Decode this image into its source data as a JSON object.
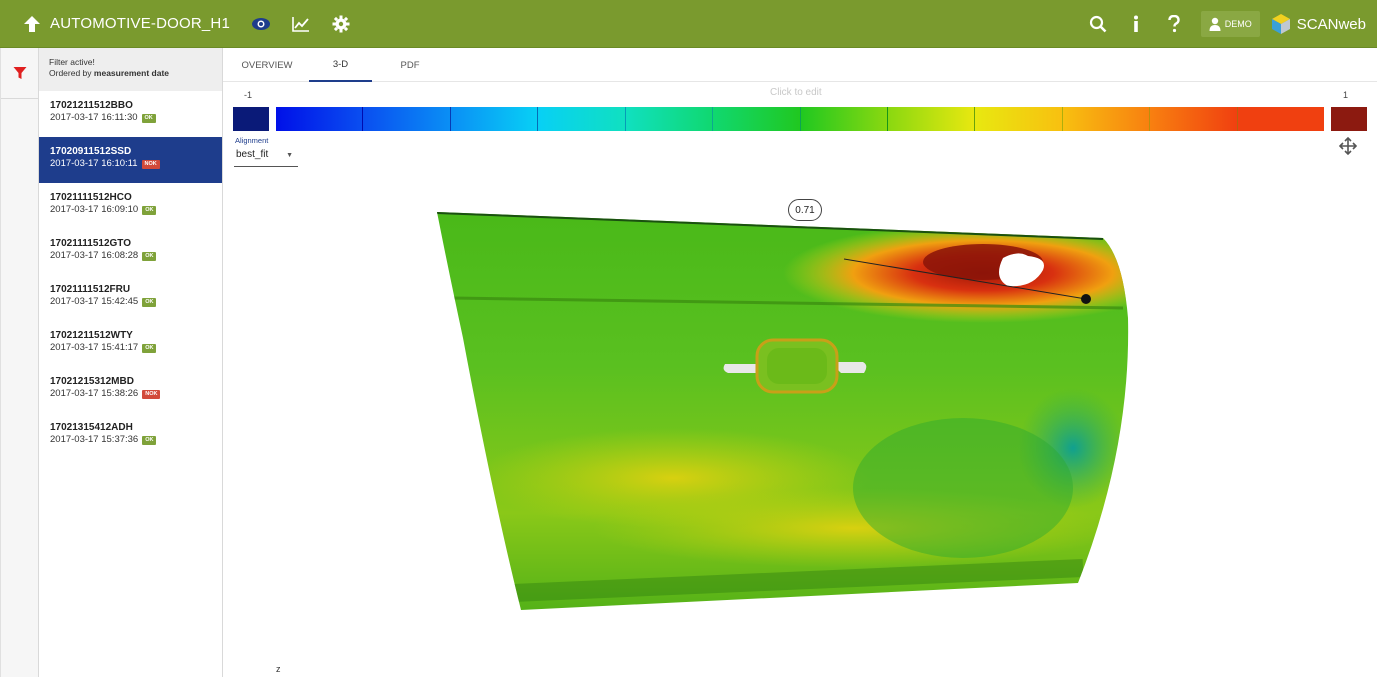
{
  "header": {
    "title": "AUTOMOTIVE-DOOR_H1",
    "user": "DEMO",
    "brand": "SCANweb"
  },
  "list": {
    "filter_status": "Filter active!",
    "order_prefix": "Ordered by",
    "order_field": "measurement date",
    "items": [
      {
        "code": "17021211512BBO",
        "date": "2017-03-17 16:11:30",
        "status": "OK"
      },
      {
        "code": "17020911512SSD",
        "date": "2017-03-17 16:10:11",
        "status": "NOK"
      },
      {
        "code": "17021111512HCO",
        "date": "2017-03-17 16:09:10",
        "status": "OK"
      },
      {
        "code": "17021111512GTO",
        "date": "2017-03-17 16:08:28",
        "status": "OK"
      },
      {
        "code": "17021111512FRU",
        "date": "2017-03-17 15:42:45",
        "status": "OK"
      },
      {
        "code": "17021211512WTY",
        "date": "2017-03-17 15:41:17",
        "status": "OK"
      },
      {
        "code": "17021215312MBD",
        "date": "2017-03-17 15:38:26",
        "status": "NOK"
      },
      {
        "code": "17021315412ADH",
        "date": "2017-03-17 15:37:36",
        "status": "OK"
      }
    ]
  },
  "tabs": [
    "OVERVIEW",
    "3-D",
    "PDF"
  ],
  "viewer": {
    "hint": "Click to edit",
    "scale_min": "-1",
    "scale_max": "1",
    "alignment_label": "Alignment",
    "alignment_value": "best_fit",
    "callout_value": "0.71",
    "axis_label": "z",
    "colors": [
      "#0010e8",
      "#0a4ef0",
      "#0a8ff5",
      "#08d0f5",
      "#10e0c0",
      "#10d870",
      "#20c820",
      "#8ad810",
      "#e8e810",
      "#f8c010",
      "#f88010",
      "#f04010"
    ],
    "min_color": "#0a1a78",
    "max_color": "#8c1a10"
  }
}
